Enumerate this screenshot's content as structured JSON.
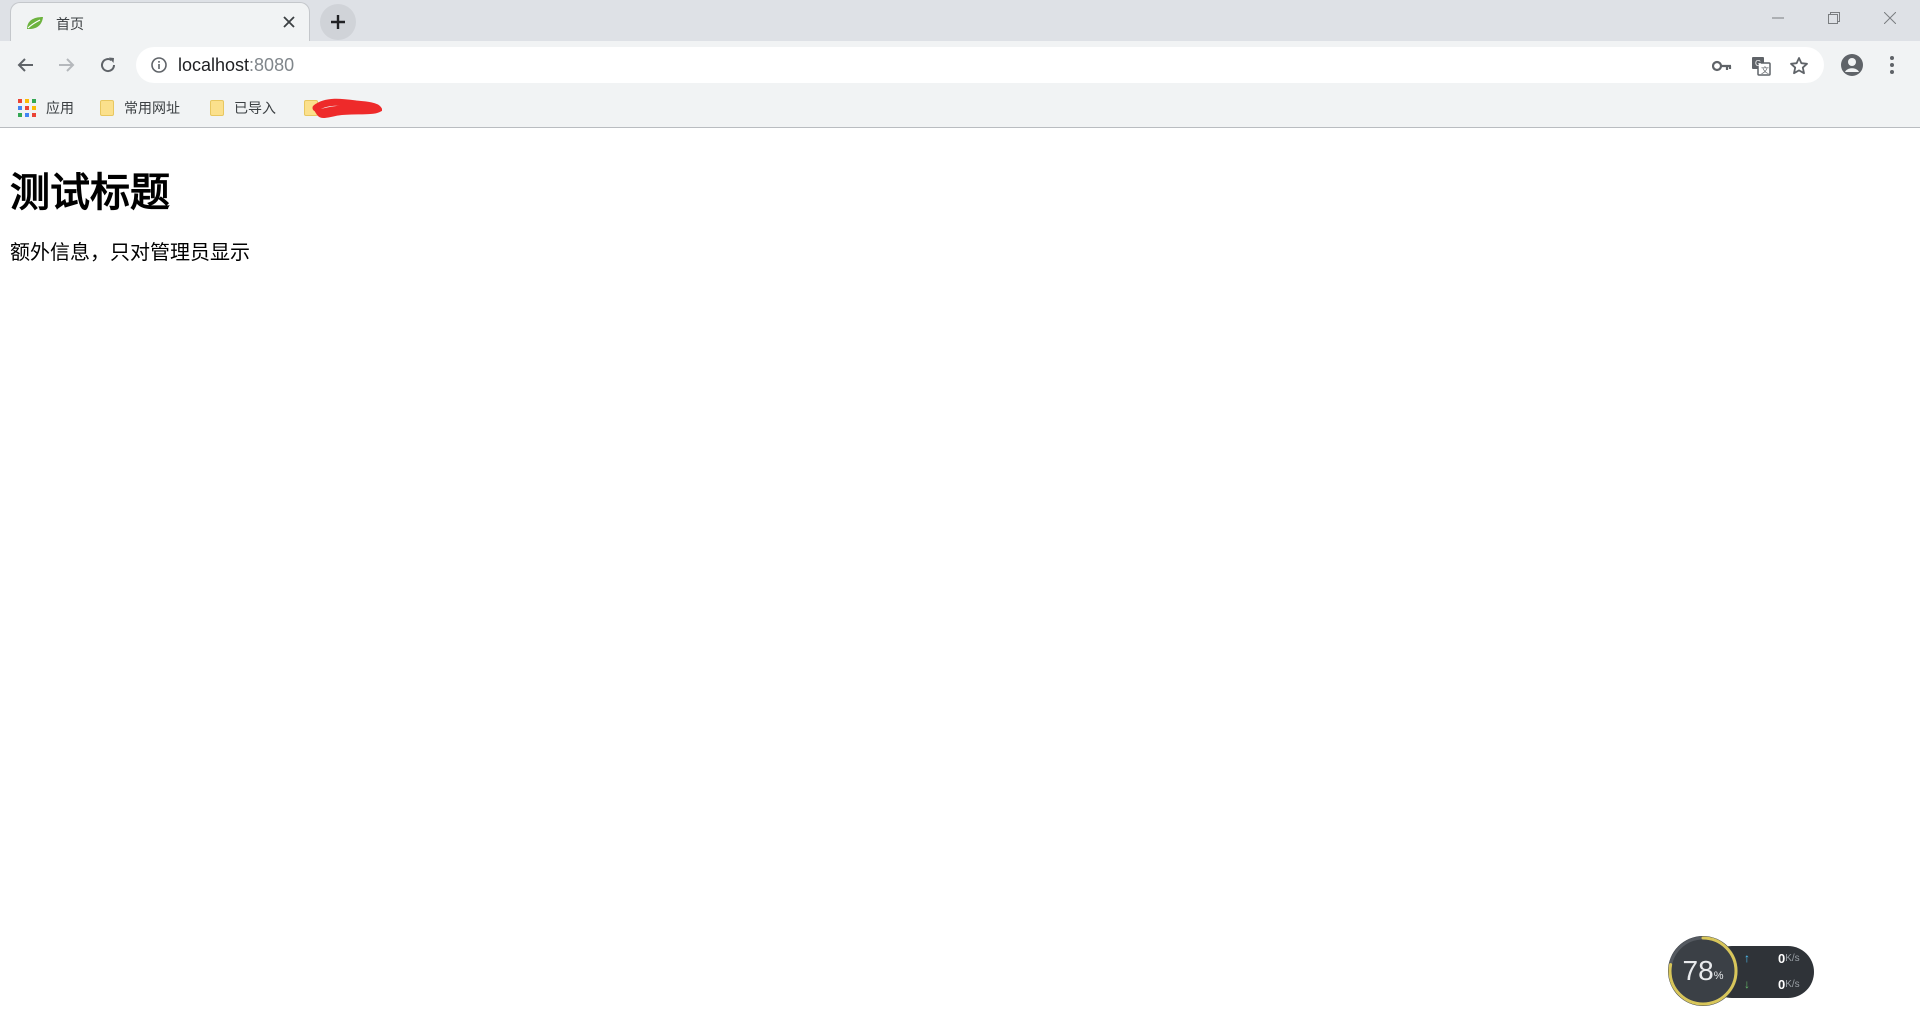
{
  "tab": {
    "title": "首页",
    "favicon": "spring-leaf-icon"
  },
  "window_controls": [
    "minimize-icon",
    "restore-icon",
    "close-icon"
  ],
  "address": {
    "host": "localhost",
    "port": ":8080"
  },
  "bookmarks": [
    {
      "label": "应用",
      "icon": "apps-grid-icon"
    },
    {
      "label": "常用网址",
      "icon": "folder-icon"
    },
    {
      "label": "已导入",
      "icon": "folder-icon"
    },
    {
      "label": "",
      "icon": "folder-icon",
      "note": "redacted"
    }
  ],
  "page": {
    "heading": "测试标题",
    "text": "额外信息，只对管理员显示"
  },
  "widget": {
    "percent": "78",
    "percent_sign": "%",
    "upload": "0",
    "download": "0",
    "unit": "K/s",
    "gauge_fraction": 0.78
  },
  "colors": {
    "tabstrip": "#dee1e6",
    "toolbar": "#f1f3f4",
    "folder": "#fbe08c",
    "redact": "#ee2a2a",
    "widget_bg": "#2f3338"
  }
}
